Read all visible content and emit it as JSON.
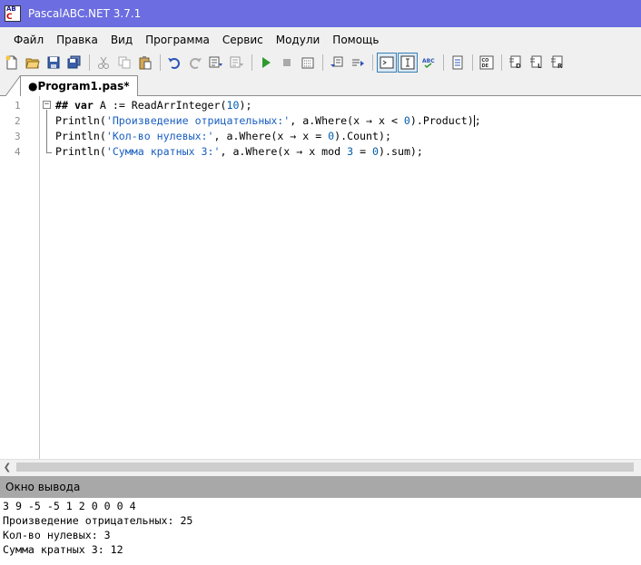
{
  "window": {
    "title": "PascalABC.NET 3.7.1",
    "icon_top": "AB",
    "icon_bottom": "C"
  },
  "menu": [
    "Файл",
    "Правка",
    "Вид",
    "Программа",
    "Сервис",
    "Модули",
    "Помощь"
  ],
  "tab": {
    "label": "●Program1.pas*"
  },
  "editor": {
    "line_numbers": [
      "1",
      "2",
      "3",
      "4"
    ],
    "lines": [
      {
        "parts": [
          {
            "t": "## ",
            "c": "kw-b"
          },
          {
            "t": "var",
            "c": "kw-b"
          },
          {
            "t": " A := ReadArrInteger(",
            "c": ""
          },
          {
            "t": "10",
            "c": "num"
          },
          {
            "t": ");",
            "c": ""
          }
        ]
      },
      {
        "parts": [
          {
            "t": "Println(",
            "c": ""
          },
          {
            "t": "'Произведение отрицательных:'",
            "c": "str"
          },
          {
            "t": ", a.Where(x → x < ",
            "c": ""
          },
          {
            "t": "0",
            "c": "num"
          },
          {
            "t": ").Product)",
            "c": ""
          },
          {
            "t": ";",
            "c": ""
          }
        ]
      },
      {
        "parts": [
          {
            "t": "Println(",
            "c": ""
          },
          {
            "t": "'Кол-во нулевых:'",
            "c": "str"
          },
          {
            "t": ", a.Where(x → x = ",
            "c": ""
          },
          {
            "t": "0",
            "c": "num"
          },
          {
            "t": ").Count);",
            "c": ""
          }
        ]
      },
      {
        "parts": [
          {
            "t": "Println(",
            "c": ""
          },
          {
            "t": "'Сумма кратных 3:'",
            "c": "str"
          },
          {
            "t": ", a.Where(x → x ",
            "c": ""
          },
          {
            "t": "mod",
            "c": ""
          },
          {
            "t": " ",
            "c": ""
          },
          {
            "t": "3",
            "c": "num"
          },
          {
            "t": " = ",
            "c": ""
          },
          {
            "t": "0",
            "c": "num"
          },
          {
            "t": ").sum);",
            "c": ""
          }
        ]
      }
    ]
  },
  "output": {
    "title": "Окно вывода",
    "lines": [
      "3 9 -5 -5 1 2 0 0 0 4",
      "Произведение отрицательных: 25",
      "Кол-во нулевых: 3",
      "Сумма кратных 3: 12"
    ]
  },
  "toolbar": {
    "buttons": [
      "new-file-icon",
      "open-folder-icon",
      "save-icon",
      "save-all-icon",
      "cut-icon",
      "copy-icon",
      "paste-icon",
      "undo-icon",
      "redo-icon",
      "indent-icon",
      "outdent-icon",
      "run-icon",
      "stop-icon",
      "compile-icon",
      "debug-step-icon",
      "debug-step-over-icon",
      "console-icon",
      "text-cursor-icon",
      "spell-check-icon",
      "format-icon",
      "code-template-icon",
      "debug-d-icon",
      "debug-l-icon",
      "debug-r-icon"
    ]
  },
  "colors": {
    "titlebar": "#6b6de0",
    "string": "#1a5ec0",
    "number": "#005caa",
    "output_header": "#a8a8a8"
  }
}
